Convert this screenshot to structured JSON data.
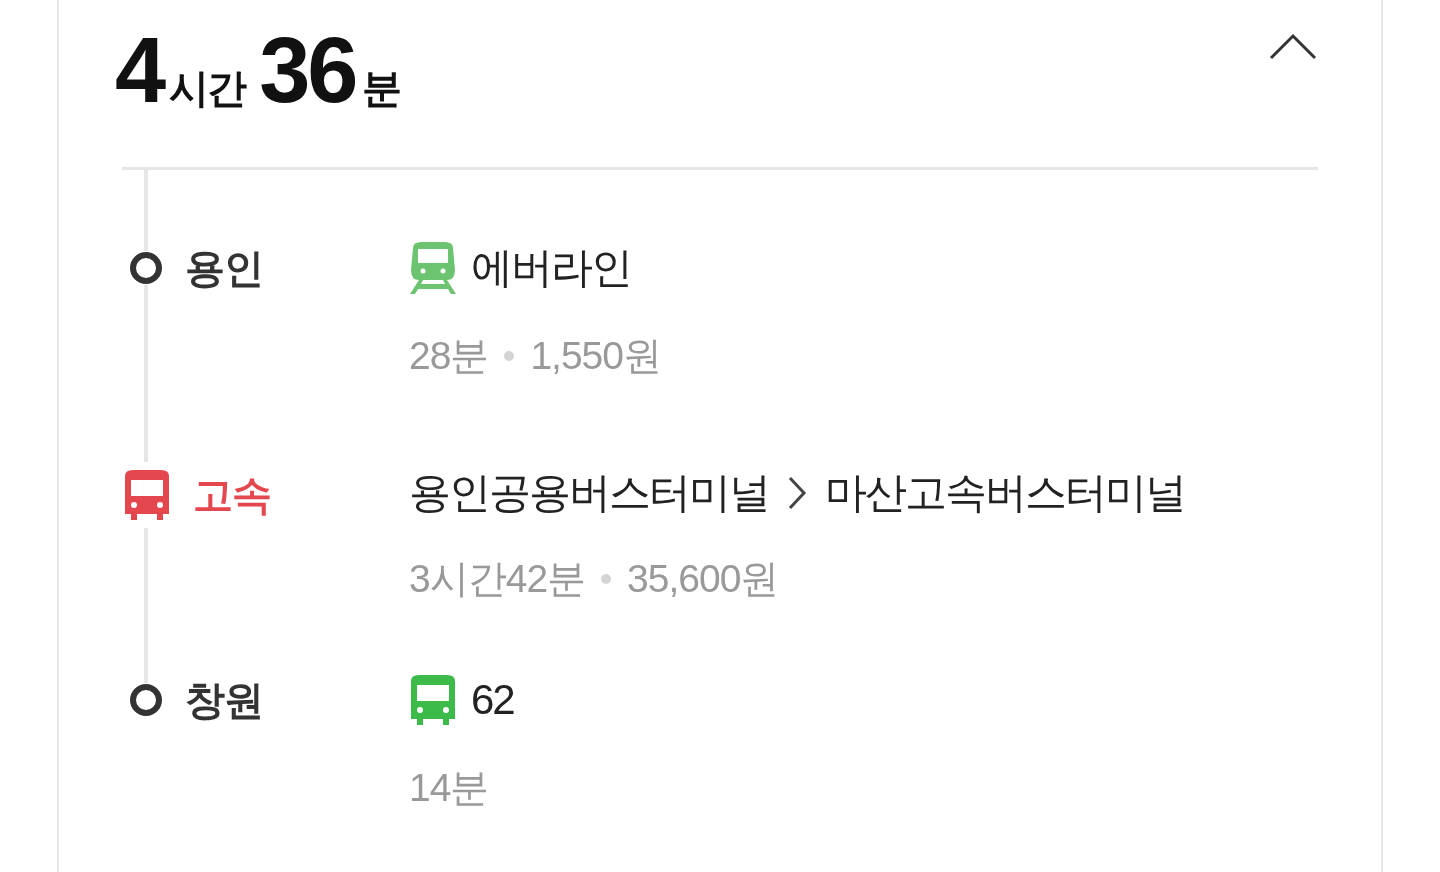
{
  "summary": {
    "hours": "4",
    "hours_unit": "시간",
    "minutes": "36",
    "minutes_unit": "분",
    "expanded": true
  },
  "steps": [
    {
      "kind": "rail",
      "color": "#333333",
      "label": "용인",
      "name": "에버라인",
      "duration": "28분",
      "fare": "1,550원"
    },
    {
      "kind": "express",
      "color": "#e5474f",
      "label": "고속",
      "from": "용인공용버스터미널",
      "to": "마산고속버스터미널",
      "duration": "3시간42분",
      "fare": "35,600원"
    },
    {
      "kind": "bus",
      "color": "#333333",
      "label": "창원",
      "name": "62",
      "duration": "14분"
    }
  ]
}
